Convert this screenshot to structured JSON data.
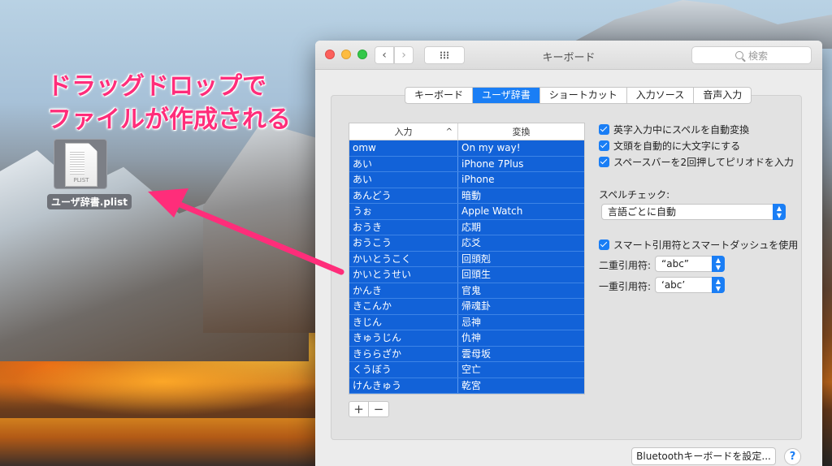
{
  "annotation": {
    "line1": "ドラッグドロップで",
    "line2": "ファイルが作成される",
    "color": "#ff2d7a"
  },
  "desktop_file": {
    "icon_text": "PLIST",
    "label": "ユーザ辞書.plist"
  },
  "window": {
    "title": "キーボード",
    "search_placeholder": "検索",
    "icons": [
      "close-light",
      "minimize-light",
      "zoom-light",
      "back-chevron-icon",
      "forward-chevron-icon",
      "grid-icon",
      "search-icon"
    ],
    "back_glyph": "‹",
    "fwd_glyph": "›"
  },
  "tabs": [
    {
      "label": "キーボード",
      "active": false
    },
    {
      "label": "ユーザ辞書",
      "active": true
    },
    {
      "label": "ショートカット",
      "active": false
    },
    {
      "label": "入力ソース",
      "active": false
    },
    {
      "label": "音声入力",
      "active": false
    }
  ],
  "table": {
    "headers": {
      "input": "入力",
      "convert": "変換",
      "sort_glyph": "^"
    },
    "rows": [
      {
        "input": "omw",
        "convert": "On my way!"
      },
      {
        "input": "あい",
        "convert": "iPhone 7Plus"
      },
      {
        "input": "あい",
        "convert": "iPhone"
      },
      {
        "input": "あんどう",
        "convert": "暗動"
      },
      {
        "input": "うぉ",
        "convert": "Apple Watch"
      },
      {
        "input": "おうき",
        "convert": "応期"
      },
      {
        "input": "おうこう",
        "convert": "応爻"
      },
      {
        "input": "かいとうこく",
        "convert": "回頭剋"
      },
      {
        "input": "かいとうせい",
        "convert": "回頭生"
      },
      {
        "input": "かんき",
        "convert": "官鬼"
      },
      {
        "input": "きこんか",
        "convert": "帰魂卦"
      },
      {
        "input": "きじん",
        "convert": "忌神"
      },
      {
        "input": "きゅうじん",
        "convert": "仇神"
      },
      {
        "input": "きららざか",
        "convert": "雲母坂"
      },
      {
        "input": "くうぼう",
        "convert": "空亡"
      },
      {
        "input": "けんきゅう",
        "convert": "乾宮"
      }
    ],
    "add_glyph": "+",
    "remove_glyph": "−",
    "selection_color": "#1262d8"
  },
  "options": {
    "autocorrect": {
      "label": "英字入力中にスペルを自動変換",
      "checked": true
    },
    "autocapitalize": {
      "label": "文頭を自動的に大文字にする",
      "checked": true
    },
    "period_shortcut": {
      "label": "スペースバーを2回押してピリオドを入力",
      "checked": true
    },
    "spell_check_label": "スペルチェック:",
    "spell_check_value": "言語ごとに自動",
    "smart_quotes": {
      "label": "スマート引用符とスマートダッシュを使用",
      "checked": true
    },
    "double_quote_label": "二重引用符:",
    "double_quote_value": "“abc”",
    "single_quote_label": "一重引用符:",
    "single_quote_value": "‘abc’"
  },
  "footer": {
    "bluetooth_button": "Bluetoothキーボードを設定...",
    "help_glyph": "?"
  },
  "colors": {
    "accent": "#1a7ef5"
  }
}
